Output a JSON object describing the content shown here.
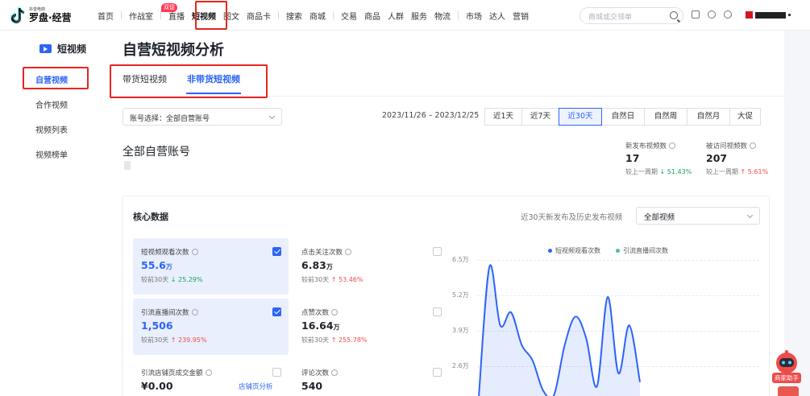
{
  "brand": {
    "small": "抖音电商",
    "name": "罗盘·经营"
  },
  "nav": {
    "items": [
      "首页",
      "作战室",
      "直播",
      "短视频",
      "图文",
      "商品卡",
      "搜索",
      "商城",
      "交易",
      "商品",
      "人群",
      "服务",
      "物流",
      "市场",
      "达人",
      "营销"
    ],
    "active": "短视频",
    "badge": "双促"
  },
  "search": {
    "placeholder": "商城或交领单"
  },
  "sidebar": {
    "title": "短视频",
    "items": [
      {
        "label": "自营视频",
        "active": true
      },
      {
        "label": "合作视频",
        "active": false
      },
      {
        "label": "视频列表",
        "active": false
      },
      {
        "label": "视频榜单",
        "active": false
      }
    ]
  },
  "page": {
    "title": "自营短视频分析",
    "tabs": [
      "带货短视频",
      "非带货短视频"
    ],
    "active_tab": "非带货短视频",
    "account_select": "账号选择：全部自营账号",
    "date_range": "2023/11/26 – 2023/12/25",
    "ranges": [
      "近1天",
      "近7天",
      "近30天",
      "自然日",
      "自然周",
      "自然月",
      "大促"
    ],
    "active_range": "近30天",
    "section_title": "全部自营账号"
  },
  "kpis": [
    {
      "label": "新发布视频数",
      "value": "17",
      "compare": "较上一周期",
      "change": "↓ 51.43%",
      "dir": "down"
    },
    {
      "label": "被访问视频数",
      "value": "207",
      "compare": "较上一周期",
      "change": "↑ 5.61%",
      "dir": "up"
    }
  ],
  "core": {
    "title": "核心数据",
    "subtitle": "近30天新发布及历史发布视频",
    "select": "全部视频",
    "metrics": [
      {
        "label": "短视频观看次数",
        "value": "55.6",
        "unit": "万",
        "compare": "较前30天",
        "change": "↓ 25.29%",
        "dir": "down",
        "checked": true
      },
      {
        "label": "点击关注次数",
        "value": "6.83",
        "unit": "万",
        "compare": "较前30天",
        "change": "↑ 53.46%",
        "dir": "up",
        "checked": false
      },
      {
        "label": "引流直播间次数",
        "value": "1,506",
        "unit": "",
        "compare": "较前30天",
        "change": "↑ 239.95%",
        "dir": "up",
        "checked": true
      },
      {
        "label": "点赞次数",
        "value": "16.64",
        "unit": "万",
        "compare": "较前30天",
        "change": "↑ 255.78%",
        "dir": "up",
        "checked": false
      },
      {
        "label": "引流店铺页成交金额",
        "value": "¥0.00",
        "unit": "",
        "link": "店铺页分析",
        "checked": false
      },
      {
        "label": "评论次数",
        "value": "540",
        "unit": "",
        "checked": false
      }
    ]
  },
  "chart_data": {
    "type": "line",
    "series": [
      {
        "name": "短视频观看次数",
        "color": "#2d64f8",
        "values": [
          0.2,
          6.2,
          3.5,
          4.1,
          2.6,
          1.9,
          0.5,
          0.3,
          2.6,
          3.9,
          2.9,
          0.7,
          4.8,
          1.3,
          3.5,
          0.9
        ]
      },
      {
        "name": "引流直播间次数",
        "color": "#4cc38a",
        "values": []
      }
    ],
    "y_ticks": [
      "6.5万",
      "5.2万",
      "3.9万",
      "2.6万"
    ],
    "ylim": [
      0,
      6.5
    ]
  },
  "assistant": {
    "label": "商家助手"
  },
  "colors": {
    "accent": "#2d64f8",
    "up": "#f04b4b",
    "down": "#17a35a",
    "highlight": "#e8261e"
  }
}
